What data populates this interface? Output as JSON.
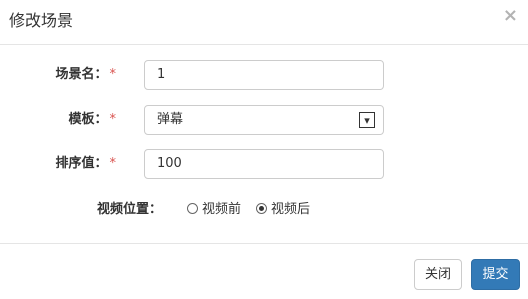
{
  "dialog": {
    "title": "修改场景",
    "close_label": "×"
  },
  "form": {
    "name": {
      "label": "场景名：",
      "required_mark": "*",
      "value": "1"
    },
    "template": {
      "label": "模板：",
      "required_mark": "*",
      "value": "弹幕",
      "icon": "dropdown-icon"
    },
    "sort": {
      "label": "排序值：",
      "required_mark": "*",
      "value": "100"
    },
    "video_position": {
      "label": "视频位置：",
      "options": [
        {
          "label": "视频前",
          "checked": false
        },
        {
          "label": "视频后",
          "checked": true
        }
      ]
    }
  },
  "footer": {
    "close_label": "关闭",
    "submit_label": "提交"
  },
  "colors": {
    "primary": "#337ab7",
    "required": "#d9534f",
    "border": "#cccccc"
  }
}
